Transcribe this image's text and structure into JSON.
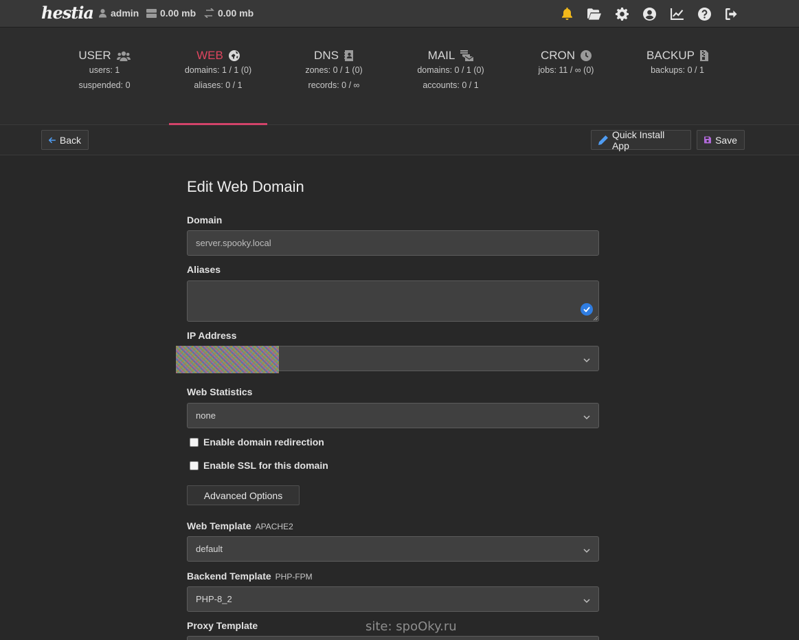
{
  "topbar": {
    "logo": "hestia",
    "user": "admin",
    "disk": "0.00 mb",
    "bandwidth": "0.00 mb",
    "icons": [
      "bell-icon",
      "folder-open-icon",
      "gear-icon",
      "user-circle-icon",
      "chart-line-icon",
      "question-circle-icon",
      "logout-icon"
    ]
  },
  "stats": [
    {
      "title": "USER",
      "icon": "users-icon",
      "lines": [
        "users: 1",
        "suspended: 0"
      ]
    },
    {
      "title": "WEB",
      "icon": "globe-icon",
      "lines": [
        "domains: 1 / 1 (0)",
        "aliases: 0 / 1"
      ],
      "active": true
    },
    {
      "title": "DNS",
      "icon": "address-book-icon",
      "lines": [
        "zones: 0 / 1 (0)",
        "records: 0 / ∞"
      ]
    },
    {
      "title": "MAIL",
      "icon": "mail-bulk-icon",
      "lines": [
        "domains: 0 / 1 (0)",
        "accounts: 0 / 1"
      ]
    },
    {
      "title": "CRON",
      "icon": "clock-icon",
      "lines": [
        "jobs: 11 / ∞ (0)"
      ]
    },
    {
      "title": "BACKUP",
      "icon": "file-archive-icon",
      "lines": [
        "backups: 0 / 1"
      ]
    }
  ],
  "toolbar": {
    "back": "Back",
    "quick_install": "Quick Install App",
    "save": "Save"
  },
  "form": {
    "title": "Edit Web Domain",
    "domain_label": "Domain",
    "domain_value": "server.spooky.local",
    "aliases_label": "Aliases",
    "aliases_value": "",
    "ip_label": "IP Address",
    "ip_value": "",
    "stats_label": "Web Statistics",
    "stats_value": "none",
    "redirect_label": "Enable domain redirection",
    "ssl_label": "Enable SSL for this domain",
    "advanced_label": "Advanced Options",
    "web_template_label": "Web Template",
    "web_template_sub": "APACHE2",
    "web_template_value": "default",
    "backend_template_label": "Backend Template",
    "backend_template_sub": "PHP-FPM",
    "backend_template_value": "PHP-8_2",
    "proxy_template_label": "Proxy Template"
  },
  "watermark": "site: spoOky.ru",
  "colors": {
    "accent": "#d2436a",
    "active_text": "#e0455f",
    "bell": "#f2b91b",
    "save_icon": "#b06ad8",
    "pencil": "#4f9cf2",
    "back_arrow": "#4f9cf2"
  }
}
